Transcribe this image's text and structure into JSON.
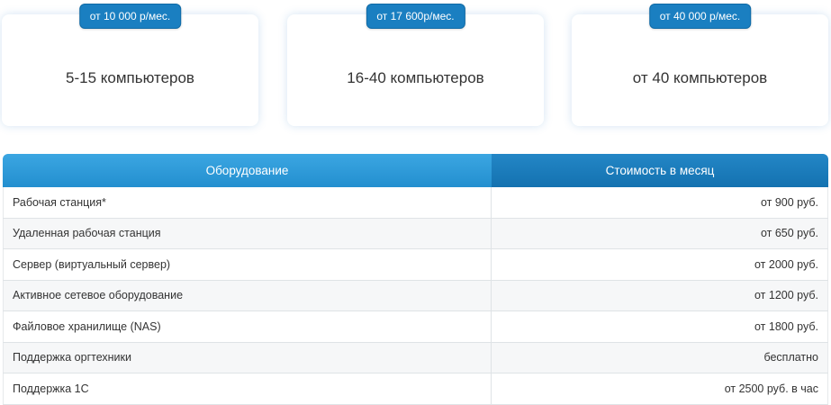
{
  "plans": [
    {
      "price_badge": "от 10 000 р/мес.",
      "title": "5-15 компьютеров"
    },
    {
      "price_badge": "от 17 600р/мес.",
      "title": "16-40 компьютеров"
    },
    {
      "price_badge": "от 40 000 р/мес.",
      "title": "от 40 компьютеров"
    }
  ],
  "table": {
    "headers": [
      "Оборудование",
      "Стоимость в месяц"
    ],
    "rows": [
      {
        "name": "Рабочая станция*",
        "price": "от 900 руб."
      },
      {
        "name": "Удаленная рабочая станция",
        "price": "от 650 руб."
      },
      {
        "name": "Сервер (виртуальный сервер)",
        "price": "от 2000 руб."
      },
      {
        "name": "Активное сетевое оборудование",
        "price": "от 1200 руб."
      },
      {
        "name": "Файловое хранилище (NAS)",
        "price": "от 1800 руб."
      },
      {
        "name": "Поддержка оргтехники",
        "price": "бесплатно"
      },
      {
        "name": "Поддержка 1С",
        "price": "от 2500 руб. в час"
      }
    ]
  },
  "colors": {
    "badge_bg": "#1a7fc1",
    "header_left": "#2b99d8",
    "header_right": "#1a7cbc"
  }
}
